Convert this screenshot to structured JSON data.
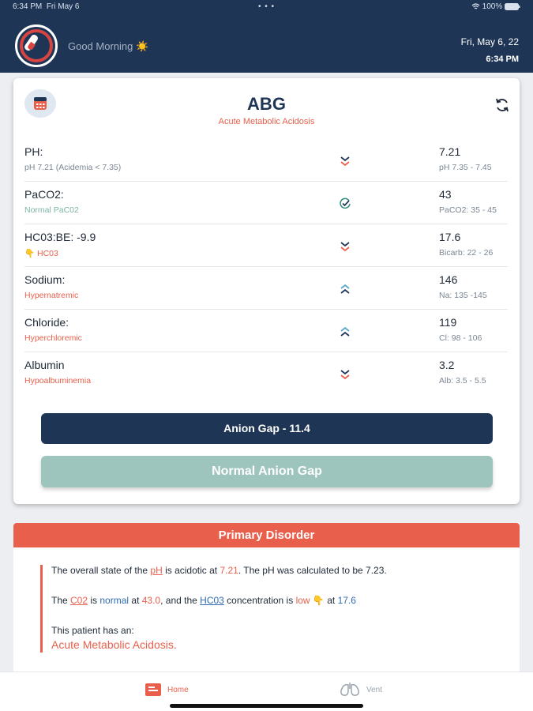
{
  "status_bar": {
    "time": "6:34 PM",
    "date": "Fri May 6",
    "dots": "• • •",
    "battery": "100%"
  },
  "header": {
    "greeting": "Good Morning ☀️",
    "date": "Fri, May 6, 22",
    "time": "6:34 PM"
  },
  "card": {
    "title": "ABG",
    "subtitle": "Acute Metabolic Acidosis",
    "rows": [
      {
        "label": "PH:",
        "note": "pH 7.21 (Acidemia < 7.35)",
        "direction": "down",
        "value": "7.21",
        "range": "pH 7.35 - 7.45"
      },
      {
        "label": "PaCO2:",
        "note": "Normal PaC02",
        "direction": "normal",
        "value": "43",
        "range": "PaCO2: 35 - 45"
      },
      {
        "label": "HC03:BE: -9.9",
        "note": "👇 HC03",
        "direction": "down",
        "value": "17.6",
        "range": "Bicarb: 22 - 26"
      },
      {
        "label": "Sodium:",
        "note": "Hypernatremic",
        "direction": "up",
        "value": "146",
        "range": "Na: 135 -145"
      },
      {
        "label": "Chloride:",
        "note": "Hyperchloremic",
        "direction": "up",
        "value": "119",
        "range": "Cl: 98 - 106"
      },
      {
        "label": "Albumin",
        "note": "Hypoalbuminemia",
        "direction": "down",
        "value": "3.2",
        "range": "Alb: 3.5 - 5.5"
      }
    ],
    "anion_gap_button": "Anion Gap - 11.4",
    "normal_gap_button": "Normal Anion Gap"
  },
  "primary_disorder": {
    "heading": "Primary Disorder",
    "line1": {
      "a": "The overall state of the ",
      "ph": "pH",
      "b": " is acidotic at ",
      "val": "7.21",
      "c": ". The pH was calculated to be 7.23."
    },
    "line2": {
      "a": "The ",
      "co2": "C02",
      "b": " is ",
      "normal": "normal",
      "c": " at ",
      "co2val": "43.0",
      "d": ", and the ",
      "hco3": "HC03",
      "e": " concentration is ",
      "low": "low",
      "emoji": "👇",
      "f": " at ",
      "hco3val": "17.6"
    },
    "line3": "This patient has an:",
    "line4": "Acute Metabolic Acidosis."
  },
  "tabbar": {
    "home": "Home",
    "vent": "Vent"
  },
  "colors": {
    "navy": "#1f3556",
    "accent": "#e8604c",
    "teal": "#9ec5bd"
  }
}
